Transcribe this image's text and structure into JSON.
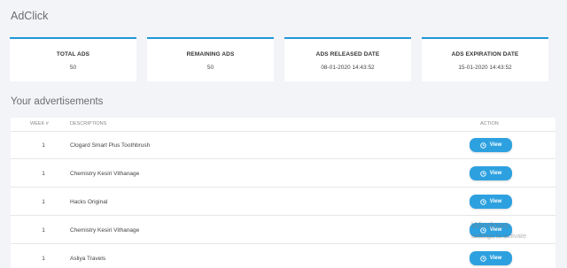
{
  "app": {
    "title": "AdClick"
  },
  "stats": [
    {
      "label": "TOTAL ADS",
      "value": "50"
    },
    {
      "label": "REMAINING ADS",
      "value": "50"
    },
    {
      "label": "ADS RELEASED DATE",
      "value": "08-01-2020 14:43:52"
    },
    {
      "label": "ADS EXPIRATION DATE",
      "value": "15-01-2020 14:43:52"
    }
  ],
  "stats_accent_color": "#2196d8",
  "ads": {
    "title": "Your advertisements",
    "columns": {
      "week": "WEEK #",
      "description": "DESCRIPTIONS",
      "action": "ACTION"
    },
    "rows": [
      {
        "week": "1",
        "description": "Clogard Smart Plus Toothbrush",
        "action": "View"
      },
      {
        "week": "1",
        "description": "Chemistry Kesiri Vithanage",
        "action": "View"
      },
      {
        "week": "1",
        "description": "Hacks Original",
        "action": "View"
      },
      {
        "week": "1",
        "description": "Chemistry Kesiri Vithanage",
        "action": "View"
      },
      {
        "week": "1",
        "description": "Asliya Travels",
        "action": "View"
      }
    ],
    "button_color": "#2da1e0",
    "button_icon": "clock-icon"
  },
  "watermark": {
    "line1": "Windows",
    "line2": "settings to activate"
  }
}
